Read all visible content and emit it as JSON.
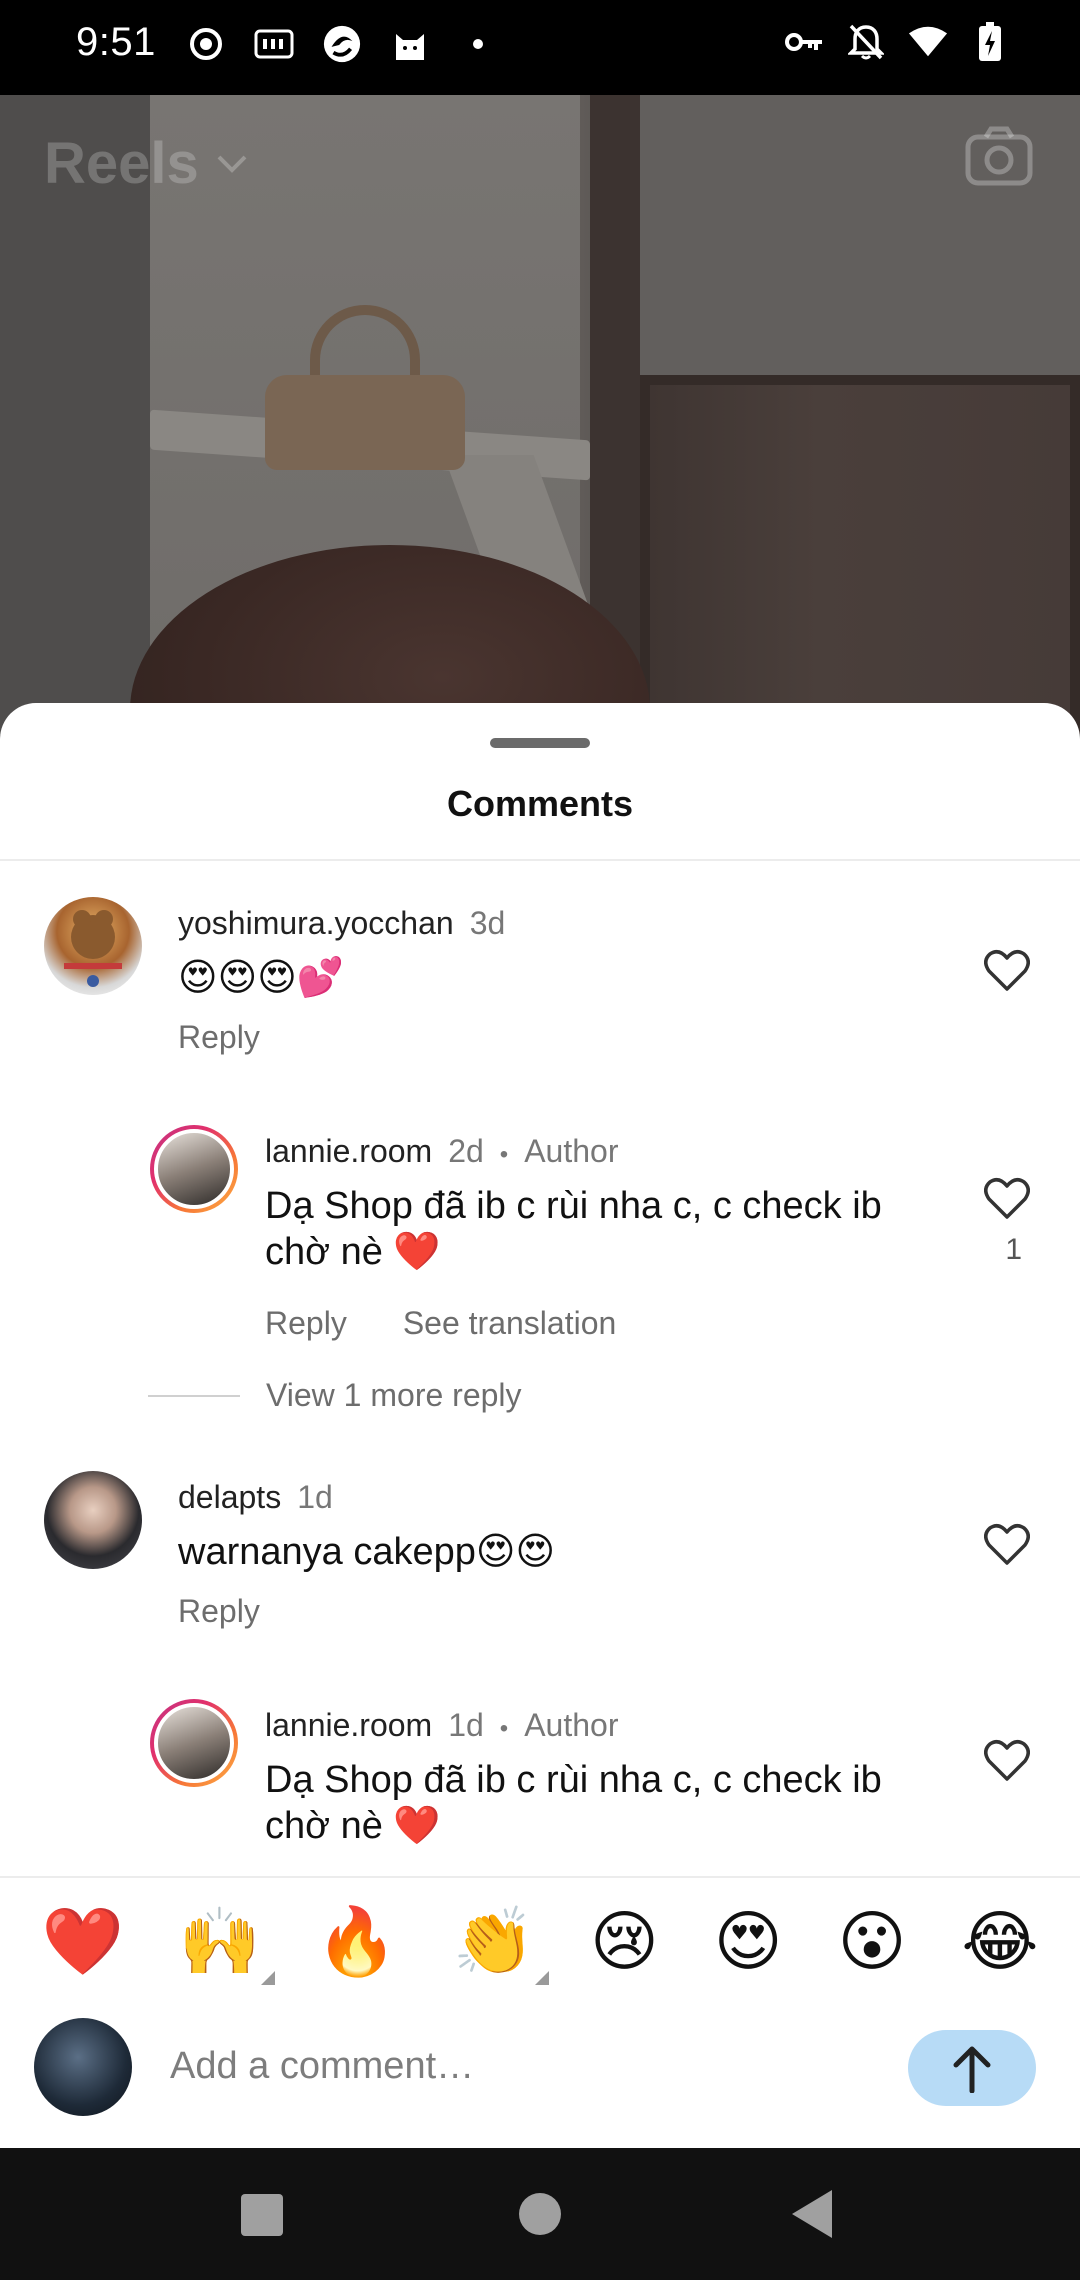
{
  "status_bar": {
    "time": "9:51"
  },
  "reels": {
    "title": "Reels"
  },
  "sheet": {
    "title": "Comments"
  },
  "comments": [
    {
      "user": "yoshimura.yocchan",
      "time": "3d",
      "author_tag": "",
      "text": "😍😍😍💕",
      "actions": [
        "Reply"
      ],
      "likes": ""
    },
    {
      "user": "lannie.room",
      "time": "2d",
      "author_tag": "Author",
      "text": "Dạ Shop đã ib c rùi nha c, c check ib chờ nè ❤️",
      "actions": [
        "Reply",
        "See translation"
      ],
      "likes": "1"
    },
    {
      "user": "delapts",
      "time": "1d",
      "author_tag": "",
      "text": "warnanya cakepp😍😍",
      "actions": [
        "Reply"
      ],
      "likes": ""
    },
    {
      "user": "lannie.room",
      "time": "1d",
      "author_tag": "Author",
      "text": "Dạ Shop đã ib c rùi nha c, c check ib chờ nè ❤️",
      "actions": [],
      "likes": ""
    }
  ],
  "view_more_replies": "View 1 more reply",
  "emoji_bar": [
    "❤️",
    "🙌",
    "🔥",
    "👏",
    "😢",
    "😍",
    "😮",
    "😂"
  ],
  "input": {
    "placeholder": "Add a comment…"
  },
  "colors": {
    "send_button": "#b7dbf6",
    "story_ring": "#e1306c"
  }
}
